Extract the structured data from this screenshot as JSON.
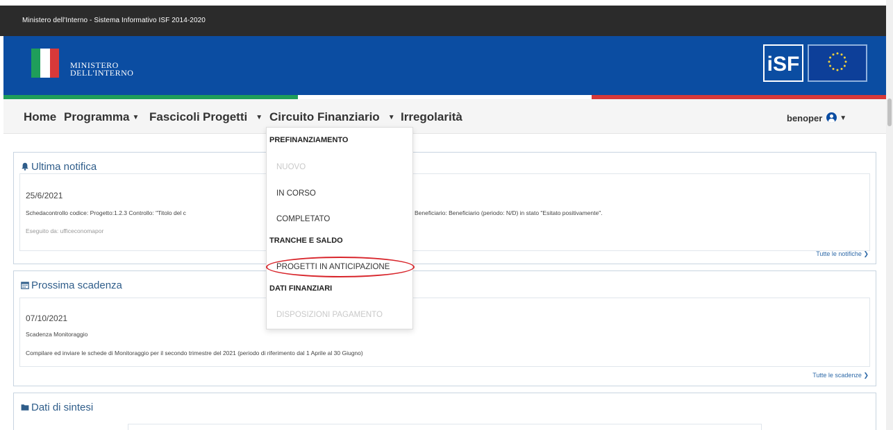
{
  "topbar": {
    "title": "Ministero dell'Interno - Sistema Informativo ISF 2014-2020"
  },
  "header": {
    "ministry_line1": "MINISTERO",
    "ministry_line2": "DELL'INTERNO",
    "isf_logo": "iSF",
    "colors": {
      "topbar": "#2b2b2b",
      "header": "#0b4da2",
      "green": "#1f9e5a",
      "red": "#d73939"
    }
  },
  "navbar": {
    "items": [
      {
        "label": "Home",
        "has_caret": false
      },
      {
        "label": "Programma",
        "has_caret": true
      },
      {
        "label": "Fascicoli",
        "has_caret": false
      },
      {
        "label": "Progetti",
        "has_caret": true
      },
      {
        "label": "Circuito Finanziario",
        "has_caret": true
      },
      {
        "label": "Irregolarità",
        "has_caret": false
      }
    ],
    "user": "benoper"
  },
  "dropdown": {
    "sections": [
      {
        "header": "PREFINANZIAMENTO",
        "items": [
          {
            "label": "NUOVO",
            "disabled": true
          },
          {
            "label": "IN CORSO",
            "disabled": false
          },
          {
            "label": "COMPLETATO",
            "disabled": false
          }
        ]
      },
      {
        "header": "TRANCHE E SALDO",
        "items": [
          {
            "label": "PROGETTI IN ANTICIPAZIONE",
            "disabled": false,
            "highlighted": true
          }
        ]
      },
      {
        "header": "DATI FINANZIARI",
        "items": [
          {
            "label": "DISPOSIZIONI PAGAMENTO",
            "disabled": true
          }
        ]
      }
    ]
  },
  "notifica": {
    "title": "Ultima notifica",
    "date": "25/6/2021",
    "text_left": "Schedacontrollo codice: Progetto:1.2.3 Controllo: \"Titolo del c",
    "text_right": "Beneficiario: Beneficiario (periodo: N/D) in stato \"Esitato positivamente\".",
    "executed_by": "Eseguito da: ufficeconomapor",
    "link": "Tutte le notifiche"
  },
  "scadenza": {
    "title": "Prossima scadenza",
    "date": "07/10/2021",
    "subject": "Scadenza Monitoraggio",
    "text": "Compilare ed inviare le schede di Monitoraggio per il secondo trimestre del 2021 (periodo di riferimento dal 1 Aprile al 30 Giugno)",
    "link": "Tutte le scadenze"
  },
  "sintesi": {
    "title": "Dati di sintesi"
  }
}
